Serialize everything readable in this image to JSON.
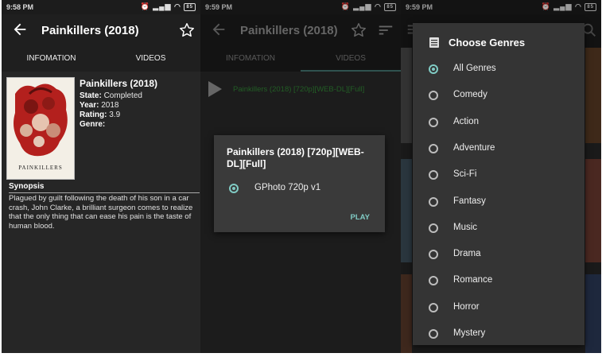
{
  "screen1": {
    "status": {
      "time": "9:58 PM",
      "battery": "85"
    },
    "appbar": {
      "title": "Painkillers (2018)"
    },
    "tabs": [
      "INFOMATION",
      "VIDEOS"
    ],
    "poster_title": "PAINKILLERS",
    "info": {
      "title": "Painkillers (2018)",
      "state_label": "State:",
      "state_value": "Completed",
      "year_label": "Year:",
      "year_value": "2018",
      "rating_label": "Rating:",
      "rating_value": "3.9",
      "genre_label": "Genre:",
      "genre_value": ""
    },
    "synopsis_heading": "Synopsis",
    "synopsis_text": "Plagued by guilt following the death of his son in a car crash, John Clarke, a brilliant surgeon comes to realize that the only thing that can ease his pain is the taste of human blood."
  },
  "screen2": {
    "status": {
      "time": "9:59 PM",
      "battery": "85"
    },
    "appbar": {
      "title": "Painkillers (2018)"
    },
    "tabs": [
      "INFOMATION",
      "VIDEOS"
    ],
    "video_item": "Painkillers (2018) [720p][WEB-DL][Full]",
    "dialog": {
      "title": "Painkillers (2018) [720p][WEB-DL][Full]",
      "option": "GPhoto 720p v1",
      "play_label": "PLAY"
    }
  },
  "screen3": {
    "status": {
      "time": "9:59 PM",
      "battery": "85"
    },
    "dialog_title": "Choose Genres",
    "genres": [
      "All Genres",
      "Comedy",
      "Action",
      "Adventure",
      "Sci-Fi",
      "Fantasy",
      "Music",
      "Drama",
      "Romance",
      "Horror",
      "Mystery"
    ],
    "selected_index": 0
  },
  "colors": {
    "accent": "#80cbc4",
    "link_green": "#2e7d32",
    "background": "#262626"
  }
}
